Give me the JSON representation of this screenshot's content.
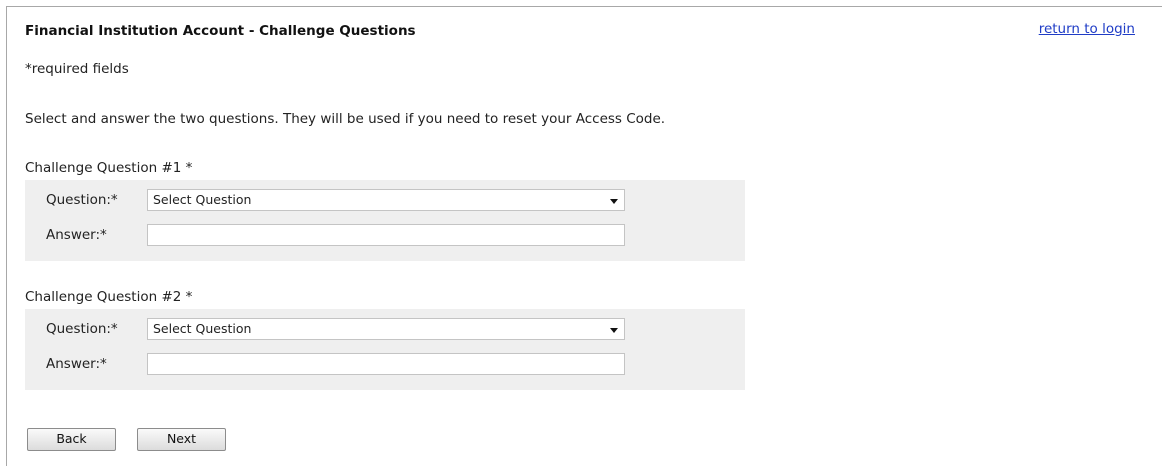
{
  "header": {
    "title": "Financial Institution Account - Challenge Questions",
    "return_link": "return to login"
  },
  "required_note": "*required fields",
  "instructions": "Select and answer the two questions. They will be used if you need to reset your Access Code.",
  "questions": [
    {
      "title": "Challenge Question #1 *",
      "question_label": "Question:*",
      "selected": "Select Question",
      "answer_label": "Answer:*",
      "answer_value": ""
    },
    {
      "title": "Challenge Question #2 *",
      "question_label": "Question:*",
      "selected": "Select Question",
      "answer_label": "Answer:*",
      "answer_value": ""
    }
  ],
  "buttons": {
    "back": "Back",
    "next": "Next"
  }
}
